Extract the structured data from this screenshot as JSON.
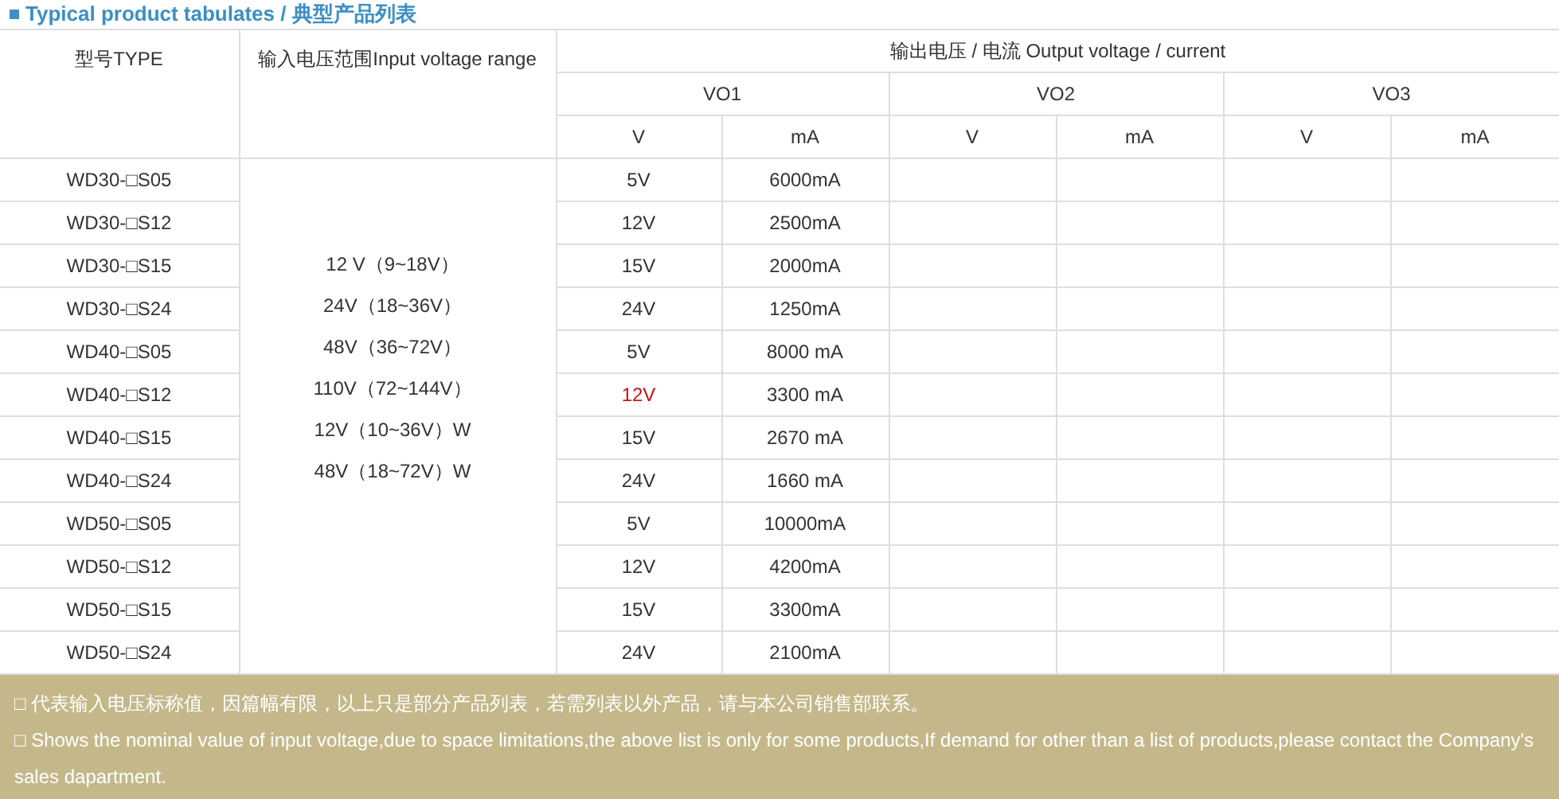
{
  "title": "Typical product tabulates / 典型产品列表",
  "table": {
    "type_heading": "型号TYPE",
    "input_heading": "输入电压范围Input voltage range",
    "output_heading": "输出电压 / 电流 Output voltage / current",
    "groups": [
      {
        "label": "VO1",
        "units": [
          "V",
          "mA"
        ]
      },
      {
        "label": "VO2",
        "units": [
          "V",
          "mA"
        ]
      },
      {
        "label": "VO3",
        "units": [
          "V",
          "mA"
        ]
      }
    ],
    "input_ranges": [
      "12 V（9~18V）",
      "24V（18~36V）",
      "48V（36~72V）",
      "110V（72~144V）",
      "12V（10~36V）W",
      "48V（18~72V）W"
    ],
    "rows": [
      {
        "model": "WD30-□S05",
        "voltage": "5V",
        "current": "6000mA",
        "highlighted": false
      },
      {
        "model": "WD30-□S12",
        "voltage": "12V",
        "current": "2500mA",
        "highlighted": false
      },
      {
        "model": "WD30-□S15",
        "voltage": "15V",
        "current": "2000mA",
        "highlighted": false
      },
      {
        "model": "WD30-□S24",
        "voltage": "24V",
        "current": "1250mA",
        "highlighted": false
      },
      {
        "model": "WD40-□S05",
        "voltage": "5V",
        "current": "8000 mA",
        "highlighted": false
      },
      {
        "model": "WD40-□S12",
        "voltage": "12V",
        "current": "3300 mA",
        "highlighted": true
      },
      {
        "model": "WD40-□S15",
        "voltage": "15V",
        "current": "2670 mA",
        "highlighted": false
      },
      {
        "model": "WD40-□S24",
        "voltage": "24V",
        "current": "1660 mA",
        "highlighted": false
      },
      {
        "model": "WD50-□S05",
        "voltage": "5V",
        "current": "10000mA",
        "highlighted": false
      },
      {
        "model": "WD50-□S12",
        "voltage": "12V",
        "current": "4200mA",
        "highlighted": false
      },
      {
        "model": "WD50-□S15",
        "voltage": "15V",
        "current": "3300mA",
        "highlighted": false
      },
      {
        "model": "WD50-□S24",
        "voltage": "24V",
        "current": "2100mA",
        "highlighted": false
      }
    ]
  },
  "notes": [
    "□ 代表输入电压标称值，因篇幅有限，以上只是部分产品列表，若需列表以外产品，请与本公司销售部联系。",
    "□ Shows the nominal value of input voltage,due to space limitations,the above list is only for some products,If demand for other than a list of products,please contact the Company's sales dapartment."
  ]
}
